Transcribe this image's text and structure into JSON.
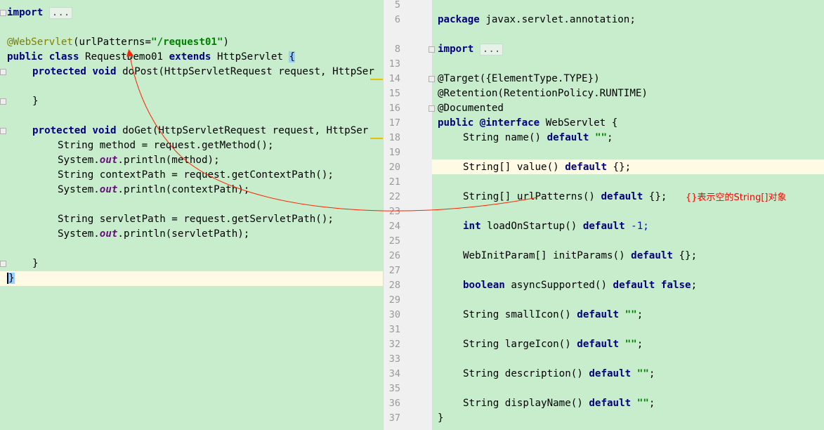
{
  "left": {
    "import_kw": "import",
    "import_fold": "...",
    "annotation": "@WebServlet",
    "annotation_args_open": "(urlPatterns=",
    "annotation_string": "\"/request01\"",
    "annotation_args_close": ")",
    "class_line": {
      "kw1": "public class",
      "name": " RequestDemo01 ",
      "kw2": "extends",
      "parent": " HttpServlet ",
      "brace": "{"
    },
    "dopost": {
      "kw": "protected void",
      "rest": " doPost(HttpServletRequest request, HttpSer"
    },
    "dopost_close": "}",
    "doget": {
      "kw": "protected void",
      "rest": " doGet(HttpServletRequest request, HttpSer"
    },
    "body": {
      "l1": "String method = request.getMethod();",
      "l2_a": "System.",
      "l2_b": "out",
      "l2_c": ".println(method);",
      "l3": "String contextPath = request.getContextPath();",
      "l4_a": "System.",
      "l4_b": "out",
      "l4_c": ".println(contextPath);",
      "l5": "String servletPath = request.getServletPath();",
      "l6_a": "System.",
      "l6_b": "out",
      "l6_c": ".println(servletPath);"
    },
    "doget_close": "}",
    "class_close": "}"
  },
  "right": {
    "line_numbers": [
      "5",
      "6",
      "8",
      "13",
      "14",
      "15",
      "16",
      "17",
      "18",
      "19",
      "20",
      "21",
      "22",
      "23",
      "24",
      "25",
      "26",
      "27",
      "28",
      "29",
      "30",
      "31",
      "32",
      "33",
      "34",
      "35",
      "36",
      "37"
    ],
    "package_kw": "package",
    "package_name": " javax.servlet.annotation;",
    "import_kw": "import",
    "import_fold": "...",
    "target": "@Target({ElementType.TYPE})",
    "retention": "@Retention(RetentionPolicy.RUNTIME)",
    "documented": "@Documented",
    "iface_kw": "public @interface",
    "iface_name": " WebServlet {",
    "name_a": "String name() ",
    "default_kw": "default",
    "empty_str": "\"\"",
    "semicolon": ";",
    "value_a": "String[] value() ",
    "empty_arr": " {};",
    "urlpatterns_a": "String[] urlPatterns() ",
    "load_a": "int",
    "load_b": " loadOnStartup() ",
    "load_val": " -1;",
    "init_a": "WebInitParam[] initParams() ",
    "async_a": "boolean",
    "async_b": " asyncSupported() ",
    "false_kw": "false",
    "small_a": "String smallIcon() ",
    "large_a": "String largeIcon() ",
    "desc_a": "String description() ",
    "display_a": "String displayName() ",
    "close_brace": "}",
    "note": "{}表示空的String[]对象"
  }
}
